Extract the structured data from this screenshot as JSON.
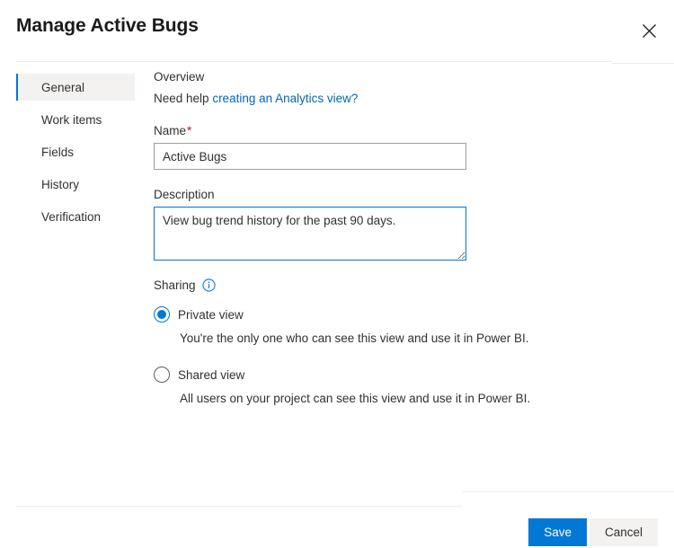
{
  "header": {
    "title": "Manage Active Bugs",
    "close_icon": "close-icon"
  },
  "sidebar": {
    "items": [
      {
        "label": "General",
        "selected": true
      },
      {
        "label": "Work items",
        "selected": false
      },
      {
        "label": "Fields",
        "selected": false
      },
      {
        "label": "History",
        "selected": false
      },
      {
        "label": "Verification",
        "selected": false
      }
    ]
  },
  "content": {
    "overview_heading": "Overview",
    "help_prefix": "Need help ",
    "help_link_text": "creating an Analytics view?",
    "name": {
      "label": "Name",
      "required_marker": "*",
      "value": "Active Bugs",
      "placeholder": ""
    },
    "description": {
      "label": "Description",
      "value": "View bug trend history for the past 90 days.",
      "placeholder": ""
    },
    "sharing": {
      "label": "Sharing",
      "info_icon": "info-icon",
      "options": [
        {
          "label": "Private view",
          "selected": true,
          "description": "You're the only one who can see this view and use it in Power BI."
        },
        {
          "label": "Shared view",
          "selected": false,
          "description": "All users on your project can see this view and use it in Power BI."
        }
      ]
    }
  },
  "footer": {
    "save_label": "Save",
    "cancel_label": "Cancel"
  },
  "colors": {
    "accent": "#0078d4",
    "link": "#0067b8",
    "required": "#a4262c",
    "divider": "#edebe9",
    "selected_bg": "#f3f2f1"
  }
}
